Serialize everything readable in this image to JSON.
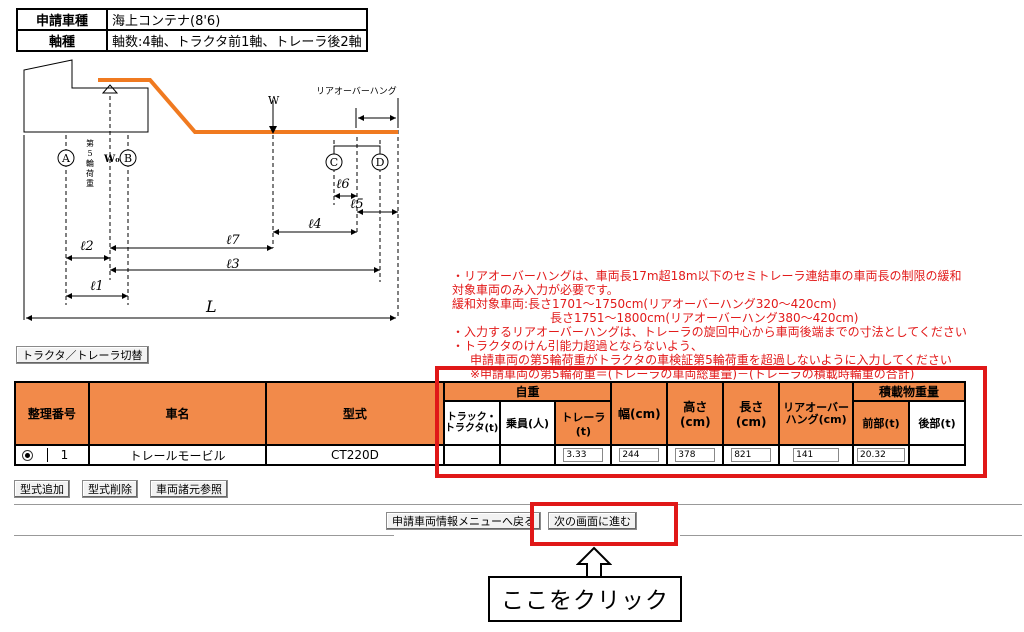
{
  "info": {
    "vehicle_type_label": "申請車種",
    "vehicle_type_value": "海上コンテナ(8'6)",
    "axle_label": "軸種",
    "axle_value": "軸数:4軸、トラクタ前1軸、トレーラ後2軸"
  },
  "diagram": {
    "rear_overhang": "リアオーバーハング",
    "w": "W",
    "wo": "W₀",
    "fifth_wheel_load": [
      "第",
      "5",
      "輪",
      "荷",
      "重"
    ],
    "points": [
      "A",
      "B",
      "C",
      "D"
    ],
    "l1": "ℓ1",
    "l2": "ℓ2",
    "l3": "ℓ3",
    "l4": "ℓ4",
    "l5": "ℓ5",
    "l6": "ℓ6",
    "l7": "ℓ7",
    "L": "L"
  },
  "notes": [
    "・リアオーバーハングは、車両長17m超18m以下のセミトレーラ連結車の車両長の制限の緩和",
    "対象車両のみ入力が必要です。",
    "緩和対象車両:長さ1701～1750cm(リアオーバーハング320～420cm)",
    "長さ1751～1800cm(リアオーバーハング380～420cm)",
    "・入力するリアオーバーハングは、トレーラの旋回中心から車両後端までの寸法としてください",
    "・トラクタのけん引能力超過とならないよう、",
    "申請車両の第5輪荷重がトラクタの車検証第5輪荷重を超過しないように入力してください",
    "※申請車両の第5輪荷重＝(トレーラの車両総重量)－(トレーラの積載時輪重の合計)"
  ],
  "switch_button": "トラクタ／トレーラ切替",
  "table": {
    "headers": {
      "number": "整理番号",
      "name": "車名",
      "model": "型式",
      "self_weight": "自重",
      "tractor": "トラック・トラクタ(t)",
      "passengers": "乗員(人)",
      "trailer": "トレーラ(t)",
      "width": "幅(cm)",
      "height": "高さ(cm)",
      "length": "長さ(cm)",
      "overhang": "リアオーバーハング(cm)",
      "cargo_weight": "積載物重量",
      "front": "前部(t)",
      "rear": "後部(t)"
    },
    "row": {
      "number": "1",
      "name": "トレールモービル",
      "model": "CT220D",
      "tractor": "",
      "passengers": "",
      "trailer": "3.33",
      "width": "244",
      "height": "378",
      "length": "821",
      "overhang": "141",
      "front": "20.32",
      "rear": ""
    }
  },
  "buttons": {
    "add_model": "型式追加",
    "delete_model": "型式削除",
    "spec_reference": "車両諸元参照",
    "back_menu": "申請車両情報メニューへ戻る",
    "next_screen": "次の画面に進む"
  },
  "callout": "ここをクリック",
  "colors": {
    "accent": "#f28a4a",
    "highlight": "#e01818",
    "note": "#e21a1a"
  }
}
